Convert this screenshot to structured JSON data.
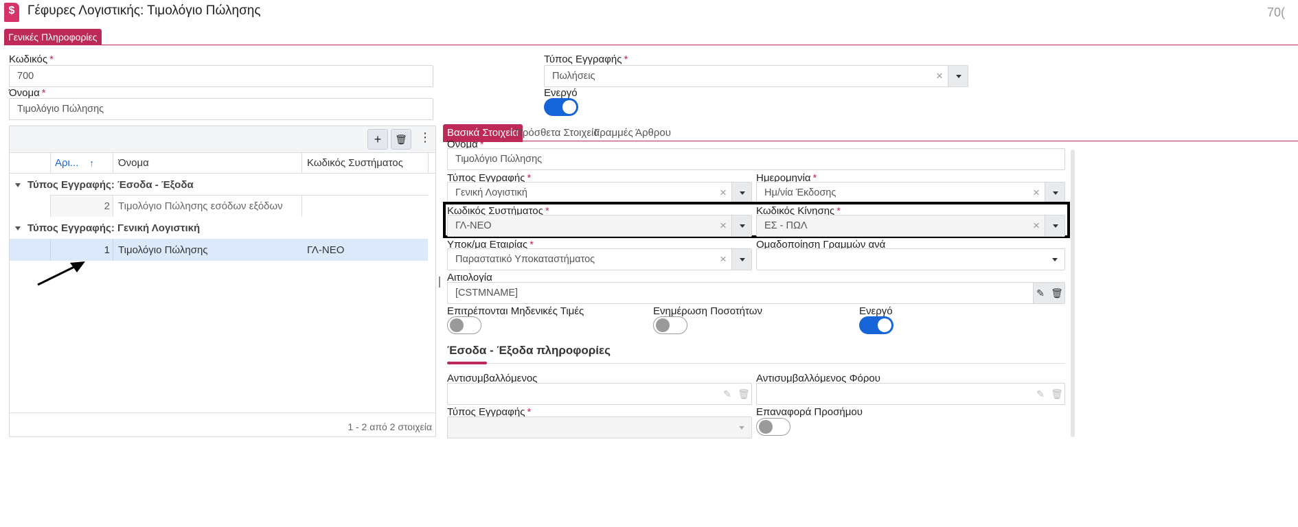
{
  "header": {
    "title": "Γέφυρες Λογιστικής: Τιμολόγιο Πώλησης",
    "corner_text": "70("
  },
  "top_tab": "Γενικές Πληροφορίες",
  "form": {
    "code_label": "Κωδικός",
    "code_value": "700",
    "name_label": "Όνομα",
    "name_value": "Τιμολόγιο Πώλησης",
    "type_label": "Τύπος Εγγραφής",
    "type_value": "Πωλήσεις",
    "active_label": "Ενεργό"
  },
  "grid": {
    "toolbar": {
      "add": "+",
      "delete": "🗑",
      "more": "⋮"
    },
    "columns": [
      "Αρι...",
      "Όνομα",
      "Κωδικός Συστήματος"
    ],
    "groups": [
      {
        "label": "Τύπος Εγγραφής: Έσοδα - Έξοδα",
        "rows": [
          {
            "num": "2",
            "name": "Τιμολόγιο Πώλησης εσόδων εξόδων",
            "system_code": ""
          }
        ]
      },
      {
        "label": "Τύπος Εγγραφής: Γενική Λογιστική",
        "rows": [
          {
            "num": "1",
            "name": "Τιμολόγιο Πώλησης",
            "system_code": "ΓΛ-ΝΕΟ"
          }
        ]
      }
    ],
    "footer": "1 - 2 από 2 στοιχεία"
  },
  "detail": {
    "tabs": [
      "Βασικά Στοιχεία",
      "Πρόσθετα Στοιχεία",
      "Γραμμές Άρθρου"
    ],
    "name_label": "Όνομα",
    "name_value": "Τιμολόγιο Πώλησης",
    "type_label": "Τύπος Εγγραφής",
    "type_value": "Γενική Λογιστική",
    "date_label": "Ημερομηνία",
    "date_value": "Ημ/νία Έκδοσης",
    "system_code_label": "Κωδικός Συστήματος",
    "system_code_value": "ΓΛ-ΝΕΟ",
    "move_code_label": "Κωδικός Κίνησης",
    "move_code_value": "ΕΣ - ΠΩΛ",
    "branch_label": "Υποκ/μα Εταιρίας",
    "branch_value": "Παραστατικό Υποκαταστήματος",
    "grouping_label": "Ομαδοποίηση Γραμμών ανά",
    "grouping_value": "",
    "reason_label": "Αιτιολογία",
    "reason_value": "[CSTMNAME]",
    "zero_label": "Επιτρέπονται Μηδενικές Τιμές",
    "qty_label": "Ενημέρωση Ποσοτήτων",
    "active_label": "Ενεργό",
    "section_title": "Έσοδα - Έξοδα πληροφορίες",
    "counterparty_label": "Αντισυμβαλλόμενος",
    "tax_counterparty_label": "Αντισυμβαλλόμενος Φόρου",
    "entry_type_label": "Τύπος Εγγραφής",
    "sign_reverse_label": "Επαναφορά Προσήμου"
  },
  "colors": {
    "accent": "#bd2a57",
    "toggle_on": "#1565d8",
    "highlight_border": "#000000"
  }
}
